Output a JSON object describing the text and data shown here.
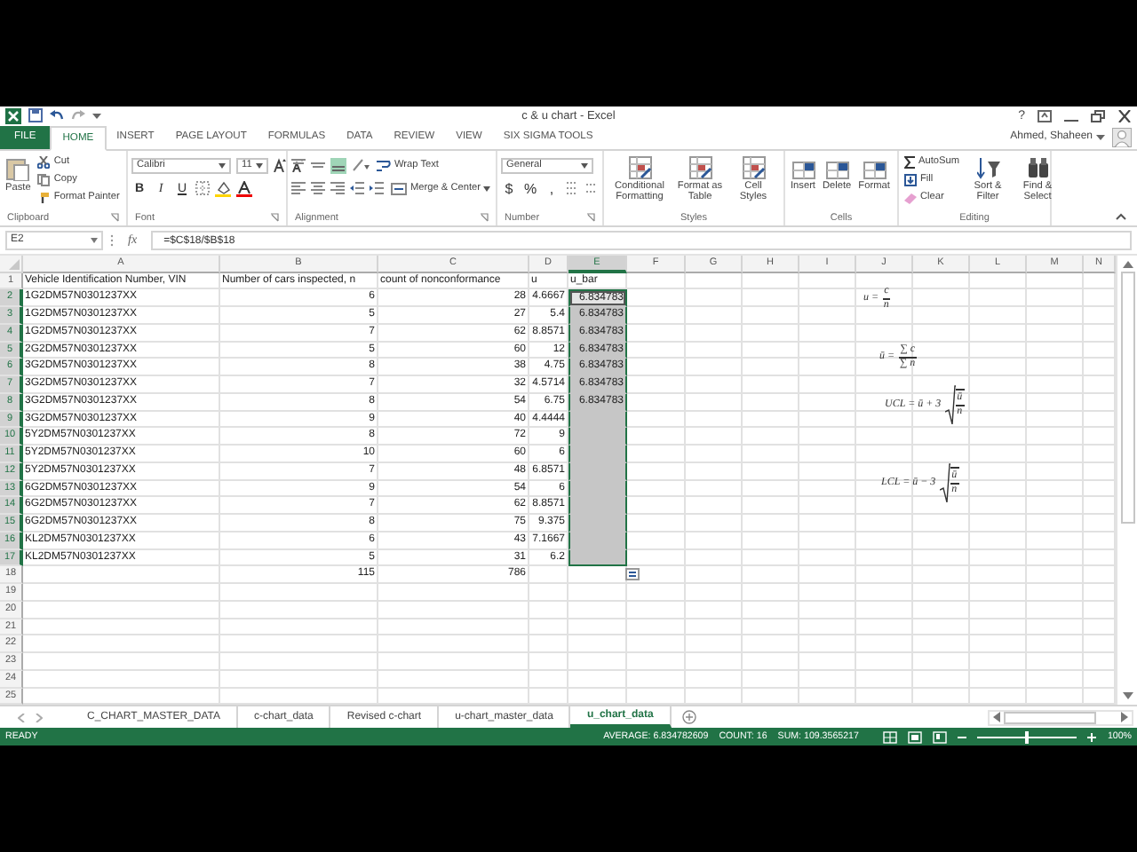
{
  "title_bar": {
    "title": "c & u chart - Excel",
    "help": "?"
  },
  "ribbon_tabs": [
    {
      "label": "FILE",
      "kind": "file",
      "selected": false
    },
    {
      "label": "HOME",
      "kind": "tab",
      "selected": true
    },
    {
      "label": "INSERT",
      "kind": "tab",
      "selected": false
    },
    {
      "label": "PAGE LAYOUT",
      "kind": "tab",
      "selected": false
    },
    {
      "label": "FORMULAS",
      "kind": "tab",
      "selected": false
    },
    {
      "label": "DATA",
      "kind": "tab",
      "selected": false
    },
    {
      "label": "REVIEW",
      "kind": "tab",
      "selected": false
    },
    {
      "label": "VIEW",
      "kind": "tab",
      "selected": false
    },
    {
      "label": "SIX SIGMA TOOLS",
      "kind": "tab",
      "selected": false
    }
  ],
  "user": {
    "name": "Ahmed, Shaheen"
  },
  "ribbon": {
    "clipboard": {
      "label": "Clipboard",
      "paste": "Paste",
      "cut": "Cut",
      "copy": "Copy",
      "format_painter": "Format Painter"
    },
    "font": {
      "label": "Font",
      "name": "Calibri",
      "size": "11",
      "bold": "B",
      "italic": "I",
      "underline": "U"
    },
    "alignment": {
      "label": "Alignment",
      "wrap": "Wrap Text",
      "merge": "Merge & Center"
    },
    "number": {
      "label": "Number",
      "format": "General",
      "currency": "$",
      "percent": "%",
      "comma": ","
    },
    "styles": {
      "label": "Styles",
      "buttons": [
        "Conditional Formatting",
        "Format as Table",
        "Cell Styles"
      ]
    },
    "cells": {
      "label": "Cells",
      "buttons": [
        "Insert",
        "Delete",
        "Format"
      ]
    },
    "editing": {
      "label": "Editing",
      "autosum": "AutoSum",
      "fill": "Fill",
      "clear": "Clear",
      "sort": "Sort & Filter",
      "find": "Find & Select"
    }
  },
  "formula_bar": {
    "name_box": "E2",
    "fx": "fx",
    "formula": "=$C$18/$B$18"
  },
  "grid": {
    "columns": [
      {
        "label": "A",
        "selected": false
      },
      {
        "label": "B",
        "selected": false
      },
      {
        "label": "C",
        "selected": false
      },
      {
        "label": "D",
        "selected": false
      },
      {
        "label": "E",
        "selected": true
      },
      {
        "label": "F",
        "selected": false
      },
      {
        "label": "G",
        "selected": false
      },
      {
        "label": "H",
        "selected": false
      },
      {
        "label": "I",
        "selected": false
      },
      {
        "label": "J",
        "selected": false
      },
      {
        "label": "K",
        "selected": false
      },
      {
        "label": "L",
        "selected": false
      },
      {
        "label": "M",
        "selected": false
      },
      {
        "label": "N",
        "selected": false
      }
    ],
    "rows": [
      {
        "label": "1",
        "kind": "header",
        "selected": false,
        "active": false,
        "cells": [
          "Vehicle Identification Number, VIN",
          "Number of cars inspected, n",
          "count of nonconformance",
          "u",
          "u_bar"
        ]
      },
      {
        "label": "2",
        "kind": "data",
        "selected": true,
        "active": true,
        "cells": [
          "1G2DM57N0301237XX",
          "6",
          "28",
          "4.6667",
          "6.834783"
        ]
      },
      {
        "label": "3",
        "kind": "data",
        "selected": true,
        "active": false,
        "cells": [
          "1G2DM57N0301237XX",
          "5",
          "27",
          "5.4",
          "6.834783"
        ]
      },
      {
        "label": "4",
        "kind": "data",
        "selected": true,
        "active": false,
        "cells": [
          "1G2DM57N0301237XX",
          "7",
          "62",
          "8.8571",
          "6.834783"
        ]
      },
      {
        "label": "5",
        "kind": "data",
        "selected": true,
        "active": false,
        "cells": [
          "2G2DM57N0301237XX",
          "5",
          "60",
          "12",
          "6.834783"
        ]
      },
      {
        "label": "6",
        "kind": "data",
        "selected": true,
        "active": false,
        "cells": [
          "3G2DM57N0301237XX",
          "8",
          "38",
          "4.75",
          "6.834783"
        ]
      },
      {
        "label": "7",
        "kind": "data",
        "selected": true,
        "active": false,
        "cells": [
          "3G2DM57N0301237XX",
          "7",
          "32",
          "4.5714",
          "6.834783"
        ]
      },
      {
        "label": "8",
        "kind": "data",
        "selected": true,
        "active": false,
        "cells": [
          "3G2DM57N0301237XX",
          "8",
          "54",
          "6.75",
          "6.834783"
        ]
      },
      {
        "label": "9",
        "kind": "data",
        "selected": true,
        "active": false,
        "cells": [
          "3G2DM57N0301237XX",
          "9",
          "40",
          "4.4444"
        ]
      },
      {
        "label": "10",
        "kind": "data",
        "selected": true,
        "active": false,
        "cells": [
          "5Y2DM57N0301237XX",
          "8",
          "72",
          "9"
        ]
      },
      {
        "label": "11",
        "kind": "data",
        "selected": true,
        "active": false,
        "cells": [
          "5Y2DM57N0301237XX",
          "10",
          "60",
          "6"
        ]
      },
      {
        "label": "12",
        "kind": "data",
        "selected": true,
        "active": false,
        "cells": [
          "5Y2DM57N0301237XX",
          "7",
          "48",
          "6.8571"
        ]
      },
      {
        "label": "13",
        "kind": "data",
        "selected": true,
        "active": false,
        "cells": [
          "6G2DM57N0301237XX",
          "9",
          "54",
          "6"
        ]
      },
      {
        "label": "14",
        "kind": "data",
        "selected": true,
        "active": false,
        "cells": [
          "6G2DM57N0301237XX",
          "7",
          "62",
          "8.8571"
        ]
      },
      {
        "label": "15",
        "kind": "data",
        "selected": true,
        "active": false,
        "cells": [
          "6G2DM57N0301237XX",
          "8",
          "75",
          "9.375"
        ]
      },
      {
        "label": "16",
        "kind": "data",
        "selected": true,
        "active": false,
        "cells": [
          "KL2DM57N0301237XX",
          "6",
          "43",
          "7.1667"
        ]
      },
      {
        "label": "17",
        "kind": "data",
        "selected": true,
        "active": false,
        "cells": [
          "KL2DM57N0301237XX",
          "5",
          "31",
          "6.2"
        ]
      },
      {
        "label": "18",
        "kind": "data",
        "selected": false,
        "active": false,
        "cells": [
          null,
          "115",
          "786"
        ]
      },
      {
        "label": "19",
        "kind": "data",
        "selected": false,
        "active": false
      },
      {
        "label": "20",
        "kind": "data",
        "selected": false,
        "active": false
      },
      {
        "label": "21",
        "kind": "data",
        "selected": false,
        "active": false
      },
      {
        "label": "22",
        "kind": "data",
        "selected": false,
        "active": false
      },
      {
        "label": "23",
        "kind": "data",
        "selected": false,
        "active": false
      },
      {
        "label": "24",
        "kind": "data",
        "selected": false,
        "active": false
      },
      {
        "label": "25",
        "kind": "data",
        "selected": false,
        "active": false
      }
    ]
  },
  "formulas": [
    {
      "kind": "fraction",
      "lhs": "u =",
      "num": "c",
      "den": "n"
    },
    {
      "kind": "fraction",
      "lhs": "ū =",
      "num": "∑ c",
      "den": "∑ n"
    },
    {
      "kind": "sqrt",
      "lhs": "UCL = ū + 3",
      "num": "ū",
      "den": "n"
    },
    {
      "kind": "sqrt",
      "lhs": "LCL = ū − 3",
      "num": "ū",
      "den": "n"
    }
  ],
  "sheet_tabs": [
    {
      "label": "C_CHART_MASTER_DATA",
      "selected": false
    },
    {
      "label": "c-chart_data",
      "selected": false
    },
    {
      "label": "Revised c-chart",
      "selected": false
    },
    {
      "label": "u-chart_master_data",
      "selected": false
    },
    {
      "label": "u_chart_data",
      "selected": true
    }
  ],
  "status_bar": {
    "mode": "READY",
    "average": "AVERAGE: 6.834782609",
    "count": "COUNT: 16",
    "sum": "SUM: 109.3565217",
    "zoom": "100%",
    "zoom_slider": {
      "level": 0.5
    }
  }
}
